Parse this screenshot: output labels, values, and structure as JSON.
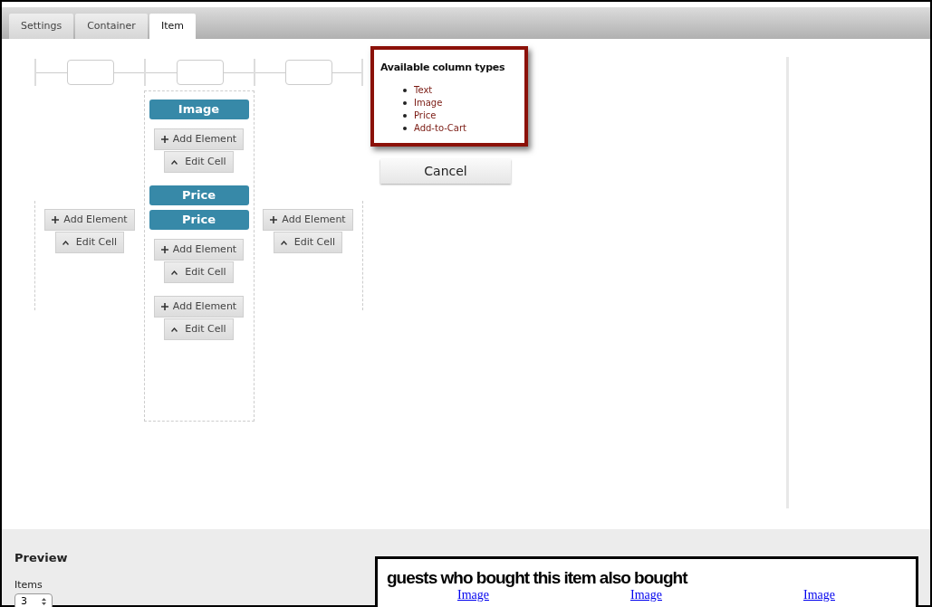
{
  "tabs": [
    {
      "label": "Settings",
      "selected": false
    },
    {
      "label": "Container",
      "selected": false
    },
    {
      "label": "Item",
      "selected": true
    }
  ],
  "columns": [
    {
      "sections": [
        {
          "add": "Add Element",
          "edit": "Edit Cell"
        }
      ]
    },
    {
      "sections": [
        {
          "elements": [
            "Image"
          ],
          "add": "Add Element",
          "edit": "Edit Cell"
        },
        {
          "elements": [
            "Price",
            "Price"
          ],
          "add": "Add Element",
          "edit": "Edit Cell"
        },
        {
          "add": "Add Element",
          "edit": "Edit Cell"
        }
      ]
    },
    {
      "sections": [
        {
          "add": "Add Element",
          "edit": "Edit Cell"
        }
      ]
    }
  ],
  "popup": {
    "title": "Available column types",
    "items": [
      "Text",
      "Image",
      "Price",
      "Add-to-Cart"
    ]
  },
  "cancel": "Cancel",
  "preview": {
    "title": "Preview",
    "items_label": "Items",
    "items_value": "3",
    "heading": "guests who bought this item also bought",
    "links": [
      "Image",
      "Image",
      "Image"
    ]
  }
}
